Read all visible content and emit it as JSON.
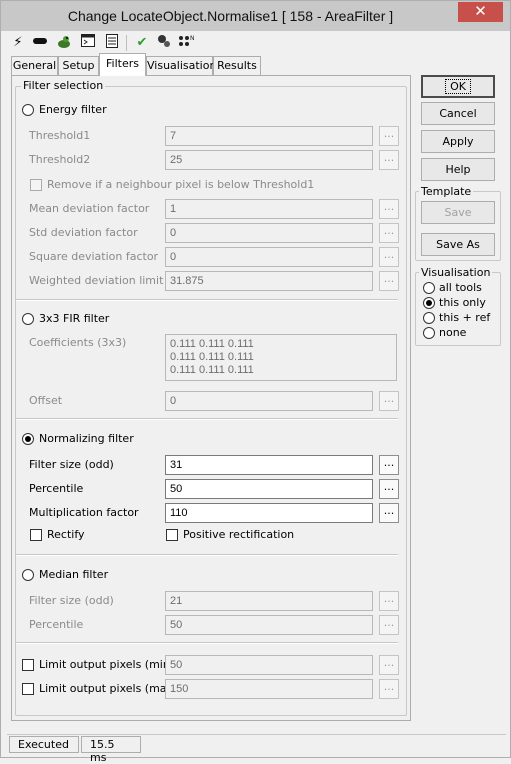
{
  "window": {
    "title": "Change LocateObject.Normalise1 [ 158 - AreaFilter ]",
    "close_glyph": "✕"
  },
  "toolbar": {
    "icons": [
      "lightning-icon",
      "link-icon",
      "frog-icon",
      "console-icon",
      "list-icon",
      "checkmark-icon",
      "tool-run-icon",
      "network-icon"
    ]
  },
  "tabs": [
    "General",
    "Setup",
    "Filters",
    "Visualisation",
    "Results"
  ],
  "active_tab": "Filters",
  "filter_selection": {
    "legend": "Filter selection",
    "energy": {
      "label": "Energy filter",
      "selected": false,
      "threshold1_label": "Threshold1",
      "threshold1_value": "7",
      "threshold2_label": "Threshold2",
      "threshold2_value": "25",
      "remove_label": "Remove if a neighbour pixel is below Threshold1",
      "mean_label": "Mean deviation factor",
      "mean_value": "1",
      "std_label": "Std deviation factor",
      "std_value": "0",
      "square_label": "Square deviation factor",
      "square_value": "0",
      "weighted_label": "Weighted deviation limit",
      "weighted_value": "31.875"
    },
    "fir": {
      "label": "3x3 FIR filter",
      "selected": false,
      "coeff_label": "Coefficients (3x3)",
      "coeff_rows": [
        "0.111 0.111 0.111",
        "0.111 0.111 0.111",
        "0.111 0.111 0.111"
      ],
      "offset_label": "Offset",
      "offset_value": "0"
    },
    "normalizing": {
      "label": "Normalizing filter",
      "selected": true,
      "size_label": "Filter size (odd)",
      "size_value": "31",
      "percentile_label": "Percentile",
      "percentile_value": "50",
      "mult_label": "Multiplication factor",
      "mult_value": "110",
      "rectify_label": "Rectify",
      "pos_rect_label": "Positive rectification"
    },
    "median": {
      "label": "Median filter",
      "selected": false,
      "size_label": "Filter size (odd)",
      "size_value": "21",
      "percentile_label": "Percentile",
      "percentile_value": "50"
    },
    "limit_min": {
      "label": "Limit output pixels (min)",
      "value": "50"
    },
    "limit_max": {
      "label": "Limit output pixels (max)",
      "value": "150"
    },
    "dots_label": "..."
  },
  "buttons": {
    "ok": "OK",
    "cancel": "Cancel",
    "apply": "Apply",
    "help": "Help"
  },
  "template": {
    "legend": "Template",
    "save": "Save",
    "save_as": "Save As"
  },
  "visualisation": {
    "legend": "Visualisation",
    "options": [
      "all tools",
      "this only",
      "this + ref",
      "none"
    ],
    "selected": "this only"
  },
  "status": {
    "state": "Executed",
    "time": "15.5 ms"
  }
}
